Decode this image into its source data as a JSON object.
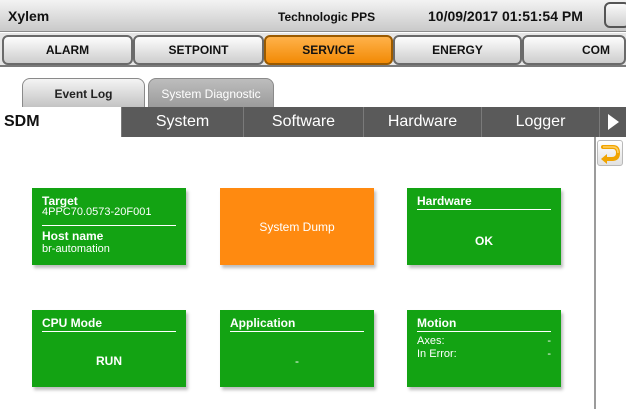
{
  "titlebar": {
    "app": "Xylem",
    "center": "Technologic PPS",
    "datetime": "10/09/2017 01:51:54 PM"
  },
  "main_tabs": [
    {
      "label": "ALARM"
    },
    {
      "label": "SETPOINT"
    },
    {
      "label": "SERVICE",
      "active": true
    },
    {
      "label": "ENERGY"
    },
    {
      "label": "COM"
    }
  ],
  "sub_tabs": [
    {
      "label": "Event Log"
    },
    {
      "label": "System Diagnostic",
      "active": true
    }
  ],
  "categories": [
    {
      "label": "SDM",
      "active": true
    },
    {
      "label": "System"
    },
    {
      "label": "Software"
    },
    {
      "label": "Hardware"
    },
    {
      "label": "Logger"
    }
  ],
  "tiles": {
    "target": {
      "title": "Target",
      "target_value": "4PPC70.0573-20F001",
      "host_label": "Host name",
      "host_value": "br-automation"
    },
    "system_dump": {
      "label": "System Dump"
    },
    "hardware": {
      "title": "Hardware",
      "status": "OK"
    },
    "cpu_mode": {
      "title": "CPU Mode",
      "status": "RUN"
    },
    "application": {
      "title": "Application",
      "value": "-"
    },
    "motion": {
      "title": "Motion",
      "axes_label": "Axes:",
      "axes_value": "-",
      "error_label": "In Error:",
      "error_value": "-"
    }
  },
  "colors": {
    "tile_green": "#13a313",
    "tile_orange": "#ff8a10",
    "active_tab": "#f28a05"
  }
}
